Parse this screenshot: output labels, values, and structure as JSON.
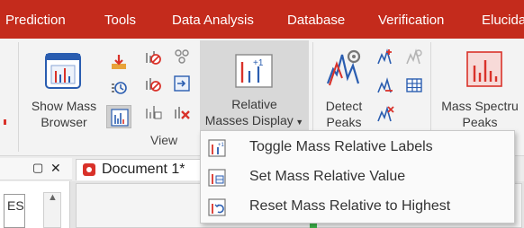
{
  "menubar": {
    "items": [
      {
        "label": "Prediction"
      },
      {
        "label": "Tools"
      },
      {
        "label": "Data Analysis"
      },
      {
        "label": "Database"
      },
      {
        "label": "Verification"
      },
      {
        "label": "Elucida"
      }
    ]
  },
  "ribbon": {
    "show_mass_browser": {
      "line1": "Show Mass",
      "line2": "Browser"
    },
    "view_group_label": "View",
    "relative_masses_display": {
      "line1": "Relative",
      "line2": "Masses Display"
    },
    "detect_peaks": {
      "line1": "Detect",
      "line2": "Peaks"
    },
    "mass_spectrum_peaks": {
      "line1": "Mass Spectru",
      "line2": "Peaks"
    }
  },
  "lower": {
    "panel_controls": {
      "dropdown_glyph": "▢",
      "close_glyph": "✕"
    },
    "document_tab": {
      "label": "Document 1*"
    },
    "side_partial_text": "ES"
  },
  "dropdown": {
    "items": [
      {
        "label": "Toggle Mass Relative Labels",
        "icon": "toggle-labels-icon"
      },
      {
        "label": "Set Mass Relative Value",
        "icon": "set-value-icon"
      },
      {
        "label": "Reset Mass Relative to Highest",
        "icon": "reset-relative-icon"
      }
    ]
  },
  "colors": {
    "menubar": "#c42b1c",
    "ribbon_bg": "#f3f3f3",
    "highlight": "#d8d8d8",
    "accent_blue": "#2a5db0",
    "accent_red": "#d9322a"
  }
}
